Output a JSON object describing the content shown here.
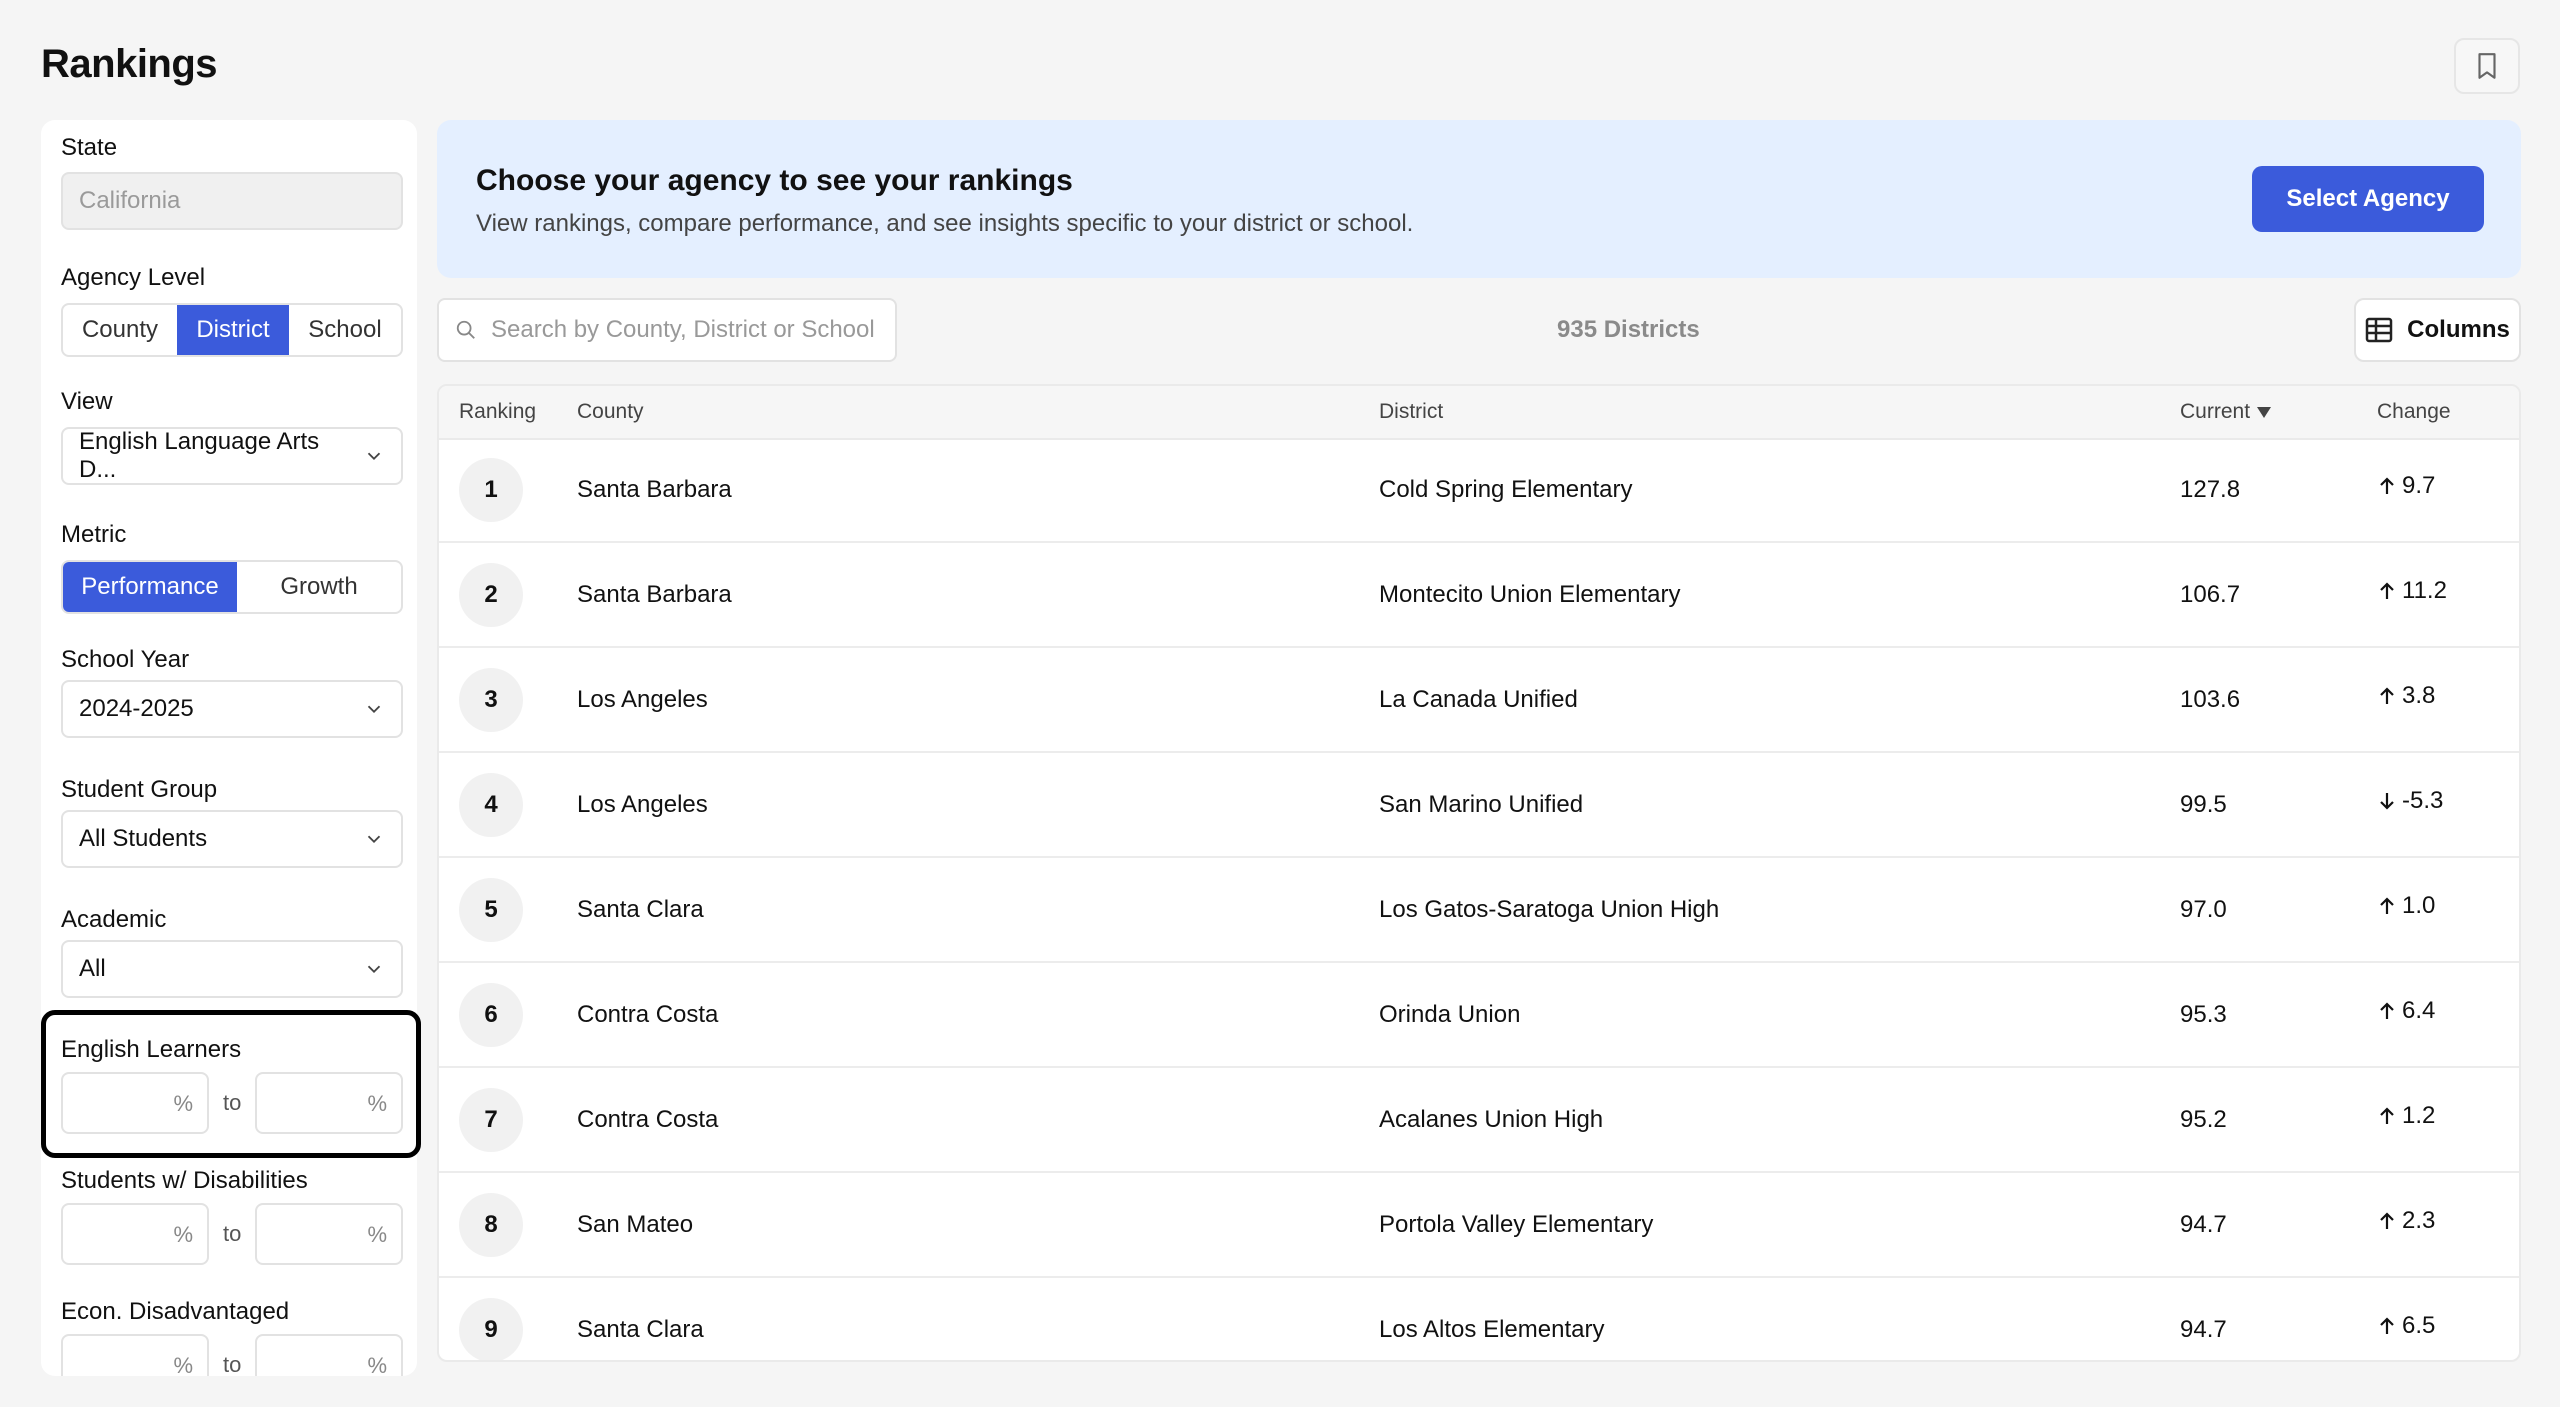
{
  "page": {
    "title": "Rankings"
  },
  "sidebar": {
    "state": {
      "label": "State",
      "value": "California"
    },
    "agency_level": {
      "label": "Agency Level",
      "options": [
        "County",
        "District",
        "School"
      ],
      "selected": "District"
    },
    "view": {
      "label": "View",
      "value": "English Language Arts D..."
    },
    "metric": {
      "label": "Metric",
      "options": [
        "Performance",
        "Growth"
      ],
      "selected": "Performance"
    },
    "school_year": {
      "label": "School Year",
      "value": "2024-2025"
    },
    "student_group": {
      "label": "Student Group",
      "value": "All Students"
    },
    "academic": {
      "label": "Academic",
      "value": "All"
    },
    "english_learners": {
      "label": "English Learners",
      "unit": "%",
      "to": "to"
    },
    "disabilities": {
      "label": "Students w/ Disabilities",
      "unit": "%",
      "to": "to"
    },
    "econ": {
      "label": "Econ. Disadvantaged",
      "unit": "%",
      "to": "to"
    }
  },
  "banner": {
    "title": "Choose your agency to see your rankings",
    "subtitle": "View rankings, compare performance, and see insights specific to your district or school.",
    "button": "Select Agency"
  },
  "toolbar": {
    "search_placeholder": "Search by County, District or School",
    "count": "935 Districts",
    "columns_label": "Columns"
  },
  "table": {
    "headers": {
      "ranking": "Ranking",
      "county": "County",
      "district": "District",
      "current": "Current",
      "change": "Change"
    },
    "rows": [
      {
        "rank": "1",
        "county": "Santa Barbara",
        "district": "Cold Spring Elementary",
        "current": "127.8",
        "change": "9.7",
        "dir": "up"
      },
      {
        "rank": "2",
        "county": "Santa Barbara",
        "district": "Montecito Union Elementary",
        "current": "106.7",
        "change": "11.2",
        "dir": "up"
      },
      {
        "rank": "3",
        "county": "Los Angeles",
        "district": "La Canada Unified",
        "current": "103.6",
        "change": "3.8",
        "dir": "up"
      },
      {
        "rank": "4",
        "county": "Los Angeles",
        "district": "San Marino Unified",
        "current": "99.5",
        "change": "-5.3",
        "dir": "down"
      },
      {
        "rank": "5",
        "county": "Santa Clara",
        "district": "Los Gatos-Saratoga Union High",
        "current": "97.0",
        "change": "1.0",
        "dir": "up"
      },
      {
        "rank": "6",
        "county": "Contra Costa",
        "district": "Orinda Union",
        "current": "95.3",
        "change": "6.4",
        "dir": "up"
      },
      {
        "rank": "7",
        "county": "Contra Costa",
        "district": "Acalanes Union High",
        "current": "95.2",
        "change": "1.2",
        "dir": "up"
      },
      {
        "rank": "8",
        "county": "San Mateo",
        "district": "Portola Valley Elementary",
        "current": "94.7",
        "change": "2.3",
        "dir": "up"
      },
      {
        "rank": "9",
        "county": "Santa Clara",
        "district": "Los Altos Elementary",
        "current": "94.7",
        "change": "6.5",
        "dir": "up"
      }
    ]
  },
  "colors": {
    "accent": "#3b5bdb",
    "banner": "#e4efff"
  },
  "icons": {
    "bookmark": "bookmark-icon",
    "search": "search-icon",
    "columns": "table-columns-icon",
    "chevron": "chevron-down-icon",
    "sort": "sort-desc-icon",
    "up": "arrow-up-icon",
    "down": "arrow-down-icon"
  }
}
